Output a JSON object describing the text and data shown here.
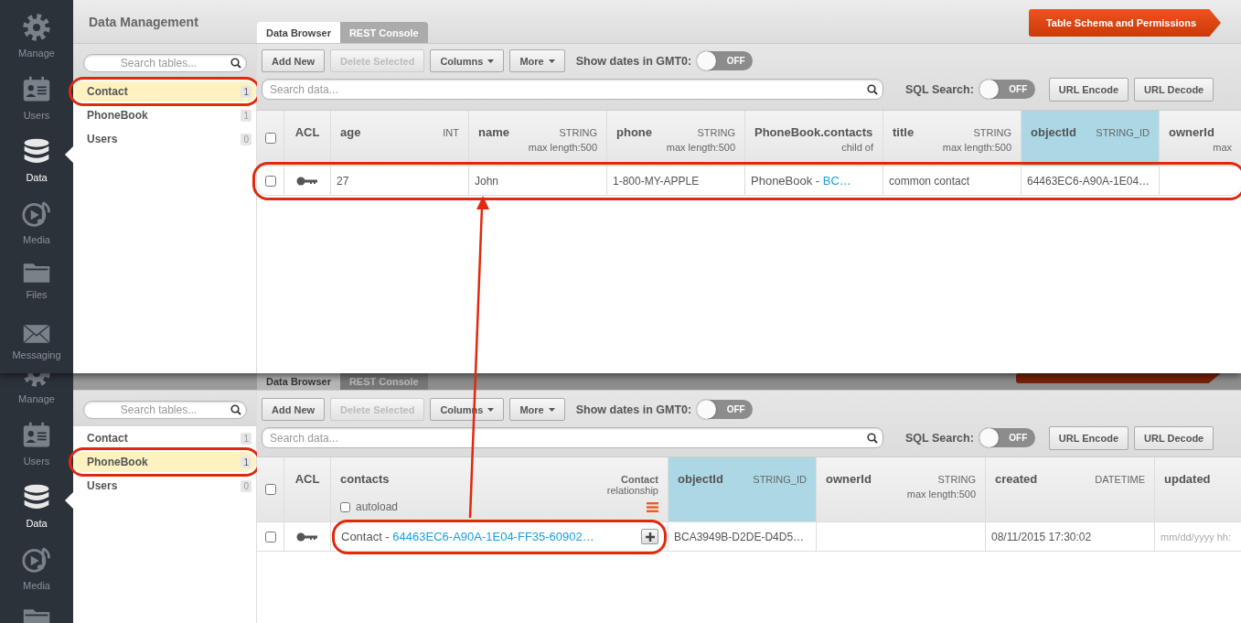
{
  "panels": [
    {
      "title": "Data Management",
      "nav": [
        {
          "label": "Manage",
          "selected": false
        },
        {
          "label": "Users",
          "selected": false
        },
        {
          "label": "Data",
          "selected": true
        },
        {
          "label": "Media",
          "selected": false
        },
        {
          "label": "Files",
          "selected": false
        },
        {
          "label": "Messaging",
          "selected": false
        }
      ],
      "tabs": [
        {
          "label": "Data Browser",
          "selected": true
        },
        {
          "label": "REST Console",
          "selected": false
        }
      ],
      "schema_button": "Table Schema and Permissions",
      "table_search": {
        "placeholder": "Search tables..."
      },
      "tables": [
        {
          "name": "Contact",
          "count": "1",
          "selected": true,
          "circled": true
        },
        {
          "name": "PhoneBook",
          "count": "1",
          "selected": false,
          "circled": false
        },
        {
          "name": "Users",
          "count": "0",
          "selected": false,
          "circled": false
        }
      ],
      "toolbar": [
        {
          "label": "Add New",
          "disabled": false,
          "dropdown": false
        },
        {
          "label": "Delete Selected",
          "disabled": true,
          "dropdown": false
        },
        {
          "label": "Columns",
          "disabled": false,
          "dropdown": true
        },
        {
          "label": "More",
          "disabled": false,
          "dropdown": true
        }
      ],
      "gmt_toggle": {
        "label": "Show dates in GMT0:",
        "on": false,
        "text": "OFF"
      },
      "data_search": {
        "placeholder": "Search data..."
      },
      "sql_toggle": {
        "label": "SQL Search:",
        "on": false,
        "text": "OFF"
      },
      "url_buttons": [
        "URL Encode",
        "URL Decode"
      ],
      "header_checked": false,
      "columns": [
        {
          "kind": "acl",
          "name": "ACL"
        },
        {
          "kind": "field",
          "name": "age",
          "type": "INT"
        },
        {
          "kind": "field",
          "name": "name",
          "type": "STRING",
          "note": "max length:500"
        },
        {
          "kind": "field",
          "name": "phone",
          "type": "STRING",
          "note": "max length:500"
        },
        {
          "kind": "field",
          "name": "PhoneBook.contacts",
          "note": "child of"
        },
        {
          "kind": "field",
          "name": "title",
          "type": "STRING",
          "note": "max length:500"
        },
        {
          "kind": "id",
          "name": "objectId",
          "type": "STRING_ID"
        },
        {
          "kind": "field",
          "name": "ownerId",
          "note": "max"
        }
      ],
      "rows": [
        {
          "checked": false,
          "circled": true,
          "cells": [
            {
              "kind": "key"
            },
            {
              "kind": "text",
              "text": "27"
            },
            {
              "kind": "text",
              "text": "John"
            },
            {
              "kind": "text",
              "text": "1-800-MY-APPLE"
            },
            {
              "kind": "link",
              "text": "PhoneBook - ",
              "link": "BC…"
            },
            {
              "kind": "text",
              "text": "common contact"
            },
            {
              "kind": "text",
              "text": "64463EC6-A90A-1E04…"
            },
            {
              "kind": "empty"
            }
          ]
        }
      ]
    },
    {
      "nav": [
        {
          "label": "Manage",
          "selected": false
        },
        {
          "label": "Users",
          "selected": false
        },
        {
          "label": "Data",
          "selected": true
        },
        {
          "label": "Media",
          "selected": false
        },
        {
          "selected": false
        }
      ],
      "tabs": [
        {
          "label": "Data Browser",
          "selected": true
        },
        {
          "label": "REST Console",
          "selected": false
        }
      ],
      "table_search": {
        "placeholder": "Search tables..."
      },
      "tables": [
        {
          "name": "Contact",
          "count": "1",
          "selected": false,
          "circled": false
        },
        {
          "name": "PhoneBook",
          "count": "1",
          "selected": true,
          "circled": true
        },
        {
          "name": "Users",
          "count": "0",
          "selected": false,
          "circled": false
        }
      ],
      "toolbar": [
        {
          "label": "Add New",
          "disabled": false,
          "dropdown": false
        },
        {
          "label": "Delete Selected",
          "disabled": true,
          "dropdown": false
        },
        {
          "label": "Columns",
          "disabled": false,
          "dropdown": true
        },
        {
          "label": "More",
          "disabled": false,
          "dropdown": true
        }
      ],
      "gmt_toggle": {
        "label": "Show dates in GMT0:",
        "on": false,
        "text": "OFF"
      },
      "data_search": {
        "placeholder": "Search data..."
      },
      "sql_toggle": {
        "label": "SQL Search:",
        "on": false,
        "text": "OFF"
      },
      "url_buttons": [
        "URL Encode",
        "URL Decode"
      ],
      "header_checked": false,
      "columns": [
        {
          "kind": "acl",
          "name": "ACL"
        },
        {
          "kind": "relation",
          "name": "contacts",
          "type": "Contact",
          "note": "relationship",
          "autoload": {
            "label": "autoload",
            "checked": false
          }
        },
        {
          "kind": "id",
          "name": "objectId",
          "type": "STRING_ID"
        },
        {
          "kind": "field",
          "name": "ownerId",
          "type": "STRING",
          "note": "max length:500"
        },
        {
          "kind": "field",
          "name": "created",
          "type": "DATETIME"
        },
        {
          "kind": "field",
          "name": "updated"
        }
      ],
      "rows": [
        {
          "checked": false,
          "circled": false,
          "cells": [
            {
              "kind": "key"
            },
            {
              "kind": "relation",
              "text": "Contact - ",
              "link": "64463EC6-A90A-1E04-FF35-60902…",
              "circled": true
            },
            {
              "kind": "text",
              "text": "BCA3949B-D2DE-D4D5…"
            },
            {
              "kind": "empty"
            },
            {
              "kind": "text",
              "text": "08/11/2015 17:30:02"
            },
            {
              "kind": "placeholder",
              "text": "mm/dd/yyyy hh:"
            }
          ]
        }
      ]
    }
  ],
  "arrow": true
}
